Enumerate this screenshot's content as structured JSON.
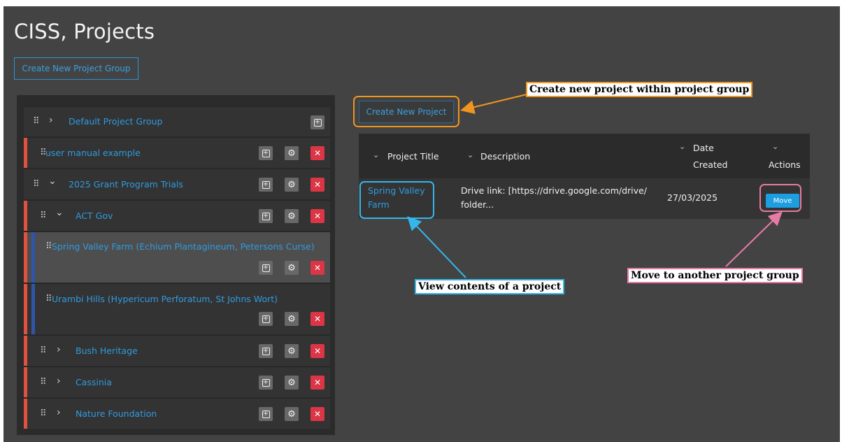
{
  "page": {
    "title": "CISS, Projects",
    "create_group_label": "Create New Project Group"
  },
  "tree": {
    "rows": [
      {
        "label": "Default Project Group"
      },
      {
        "label": "user manual example"
      },
      {
        "label": "2025 Grant Program Trials"
      },
      {
        "label": "ACT Gov"
      },
      {
        "label": "Spring Valley Farm (Echium Plantagineum, Petersons Curse)"
      },
      {
        "label": "Urambi Hills (Hypericum Perforatum, St Johns Wort)"
      },
      {
        "label": "Bush Heritage"
      },
      {
        "label": "Cassinia"
      },
      {
        "label": "Nature Foundation"
      }
    ]
  },
  "projects": {
    "create_label": "Create New Project",
    "columns": [
      {
        "line1": "Project Title"
      },
      {
        "line1": "Description"
      },
      {
        "line1": "Date",
        "line2": "Created"
      },
      {
        "line1": "Actions"
      }
    ],
    "rows": [
      {
        "title_line1": "Spring Valley",
        "title_line2": "Farm",
        "desc_line1": "Drive link: [https://drive.google.com/drive/",
        "desc_line2": "folder...",
        "date": "27/03/2025",
        "action_label": "Move"
      }
    ]
  },
  "annotations": {
    "create_project": "Create new project within project group",
    "view_contents": "View contents of a project",
    "move": "Move to another project group"
  },
  "icons": {
    "grip": "⠿",
    "chevron_right": "›",
    "chevron_down": "⌄",
    "add": "+",
    "gear": "⚙",
    "delete": "×"
  },
  "colors": {
    "background": "#434343",
    "panel": "#2b2b2b",
    "link": "#2f9be0",
    "accent_red": "#e0523f",
    "accent_blue": "#2f55a8",
    "danger": "#dc3545",
    "move_button": "#1d9ee0",
    "callout_orange": "#f0951e",
    "callout_cyan": "#35b6e8",
    "callout_pink": "#e77aa6"
  }
}
